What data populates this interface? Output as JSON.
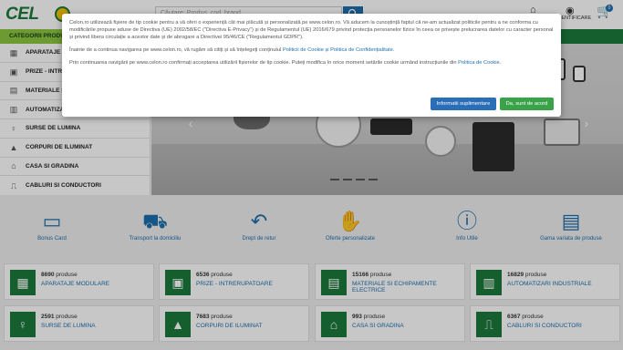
{
  "header": {
    "logo_text": "CEL",
    "search_placeholder": "Căutare: Produs, cod, brand",
    "account_label": "IDENTIFICARE",
    "cart_count": "0"
  },
  "navbar": {
    "categories_title": "CATEGORII PRODUSE"
  },
  "sidebar": {
    "items": [
      {
        "label": "APARATAJE M",
        "icon": "socket-icon"
      },
      {
        "label": "PRIZE - INTRERUPATOARE",
        "icon": "plug-icon"
      },
      {
        "label": "MATERIALE SI",
        "icon": "cable-reel-icon"
      },
      {
        "label": "AUTOMATIZARI",
        "icon": "automation-icon"
      },
      {
        "label": "SURSE DE LUMINA",
        "icon": "bulb-icon"
      },
      {
        "label": "CORPURI DE ILUMINAT",
        "icon": "lamp-icon"
      },
      {
        "label": "CASA SI GRADINA",
        "icon": "house-icon"
      },
      {
        "label": "CABLURI SI CONDUCTORI",
        "icon": "cable-icon"
      }
    ]
  },
  "services": [
    {
      "label": "Bonus Card",
      "icon": "card-icon"
    },
    {
      "label": "Transport la domiciliu",
      "icon": "truck-icon"
    },
    {
      "label": "Drept de retur",
      "icon": "return-icon"
    },
    {
      "label": "Oferte personalizate",
      "icon": "offer-hand-icon"
    },
    {
      "label": "Info Utile",
      "icon": "info-icon"
    },
    {
      "label": "Gama variata de produse",
      "icon": "laptop-list-icon"
    }
  ],
  "cards": [
    {
      "count": "8690",
      "unit": "produse",
      "name": "APARATAJE MODULARE",
      "icon": "breaker-icon"
    },
    {
      "count": "6536",
      "unit": "produse",
      "name": "PRIZE - INTRERUPATOARE",
      "icon": "socket-icon"
    },
    {
      "count": "15166",
      "unit": "produse",
      "name": "MATERIALE SI ECHIPAMENTE ELECTRICE",
      "icon": "panel-icon"
    },
    {
      "count": "16829",
      "unit": "produse",
      "name": "AUTOMATIZARI INDUSTRIALE",
      "icon": "automation-icon"
    },
    {
      "count": "2591",
      "unit": "produse",
      "name": "SURSE DE LUMINA",
      "icon": "bulb-icon"
    },
    {
      "count": "7683",
      "unit": "produse",
      "name": "CORPURI DE ILUMINAT",
      "icon": "lamp-icon"
    },
    {
      "count": "993",
      "unit": "produse",
      "name": "CASA SI GRADINA",
      "icon": "house-icon"
    },
    {
      "count": "6367",
      "unit": "produse",
      "name": "CABLURI SI CONDUCTORI",
      "icon": "cable-icon"
    }
  ],
  "cookie": {
    "para1": "Celon.ro utilizează fișiere de tip cookie pentru a vă oferi o experiență cât mai plăcută și personalizată pe www.celon.ro. Vă aducem la cunoștință faptul că ne-am actualizat politicile pentru a ne conforma cu modificările propuse aduse de Directiva (UE) 2002/58/EC (\"Directiva E-Privacy\") și de Regulamentul (UE) 2016/679 privind protecția persoanelor fizice în ceea ce privește prelucrarea datelor cu caracter personal și privind libera circulație a acestor date și de abrogare a Directivei 95/46/CE (\"Regulamentul GDPR\").",
    "para2_prefix": "Înainte de a continua navigarea pe www.celon.ro, vă rugăm să citiți și să înțelegeți conținutul ",
    "para2_link": "Politicii de Cookie și Politica de Confidențialitate",
    "para2_suffix": ".",
    "para3_prefix": "Prin continuarea navigării pe www.celon.ro confirmați acceptarea utilizării fișierelor de tip cookie. Puteți modifica în orice moment setările cookie urmând instrucțiunile din ",
    "para3_link": "Politica de Cookie",
    "para3_suffix": ".",
    "btn_info": "Informatii suplimentare",
    "btn_accept": "Da, sunt de acord"
  },
  "colors": {
    "brand_green": "#1a7a3a",
    "accent_lime": "#8cc63f",
    "link_blue": "#1d6fae",
    "accept_green": "#3aa34a",
    "info_blue": "#2a6eb8"
  }
}
